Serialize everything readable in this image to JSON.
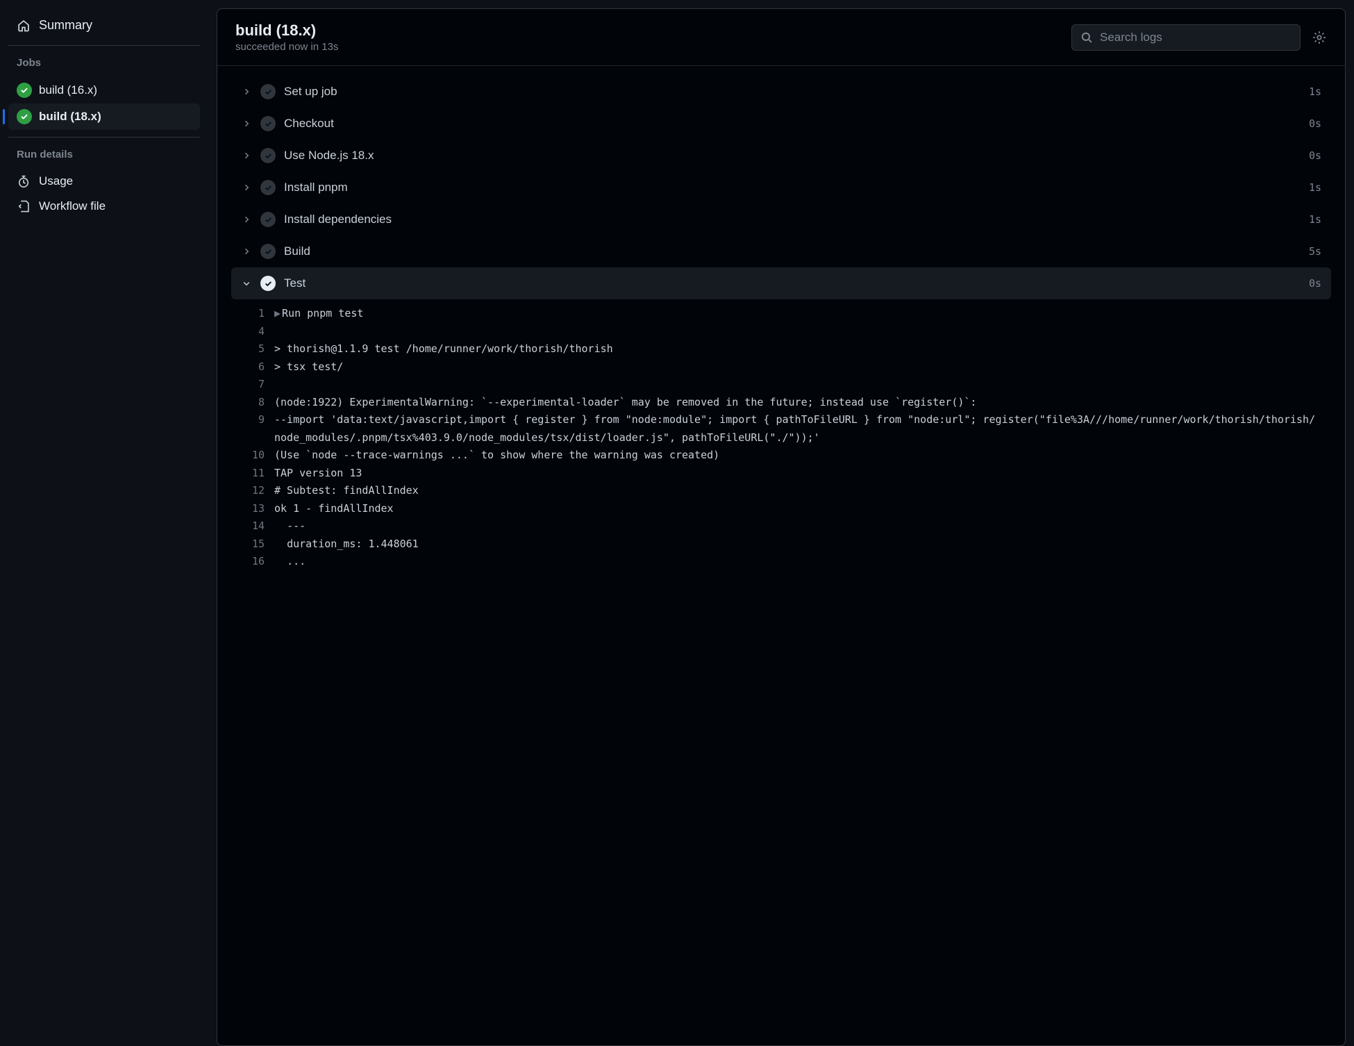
{
  "sidebar": {
    "summary_label": "Summary",
    "jobs_heading": "Jobs",
    "jobs": [
      {
        "label": "build (16.x)",
        "status": "success",
        "active": false
      },
      {
        "label": "build (18.x)",
        "status": "success",
        "active": true
      }
    ],
    "run_details_heading": "Run details",
    "run_details": [
      {
        "label": "Usage",
        "icon": "stopwatch-icon"
      },
      {
        "label": "Workflow file",
        "icon": "workflow-icon"
      }
    ]
  },
  "header": {
    "title": "build (18.x)",
    "subtitle": "succeeded now in 13s",
    "search_placeholder": "Search logs"
  },
  "steps": [
    {
      "name": "Set up job",
      "time": "1s",
      "expanded": false
    },
    {
      "name": "Checkout",
      "time": "0s",
      "expanded": false
    },
    {
      "name": "Use Node.js 18.x",
      "time": "0s",
      "expanded": false
    },
    {
      "name": "Install pnpm",
      "time": "1s",
      "expanded": false
    },
    {
      "name": "Install dependencies",
      "time": "1s",
      "expanded": false
    },
    {
      "name": "Build",
      "time": "5s",
      "expanded": false
    },
    {
      "name": "Test",
      "time": "0s",
      "expanded": true
    }
  ],
  "log_lines": [
    {
      "n": "1",
      "t": "Run pnpm test",
      "caret": true
    },
    {
      "n": "4",
      "t": ""
    },
    {
      "n": "5",
      "t": "> thorish@1.1.9 test /home/runner/work/thorish/thorish"
    },
    {
      "n": "6",
      "t": "> tsx test/"
    },
    {
      "n": "7",
      "t": ""
    },
    {
      "n": "8",
      "t": "(node:1922) ExperimentalWarning: `--experimental-loader` may be removed in the future; instead use `register()`:"
    },
    {
      "n": "9",
      "t": "--import 'data:text/javascript,import { register } from \"node:module\"; import { pathToFileURL } from \"node:url\"; register(\"file%3A///home/runner/work/thorish/thorish/node_modules/.pnpm/tsx%403.9.0/node_modules/tsx/dist/loader.js\", pathToFileURL(\"./\"));'"
    },
    {
      "n": "10",
      "t": "(Use `node --trace-warnings ...` to show where the warning was created)"
    },
    {
      "n": "11",
      "t": "TAP version 13"
    },
    {
      "n": "12",
      "t": "# Subtest: findAllIndex"
    },
    {
      "n": "13",
      "t": "ok 1 - findAllIndex"
    },
    {
      "n": "14",
      "t": "  ---"
    },
    {
      "n": "15",
      "t": "  duration_ms: 1.448061"
    },
    {
      "n": "16",
      "t": "  ..."
    }
  ]
}
